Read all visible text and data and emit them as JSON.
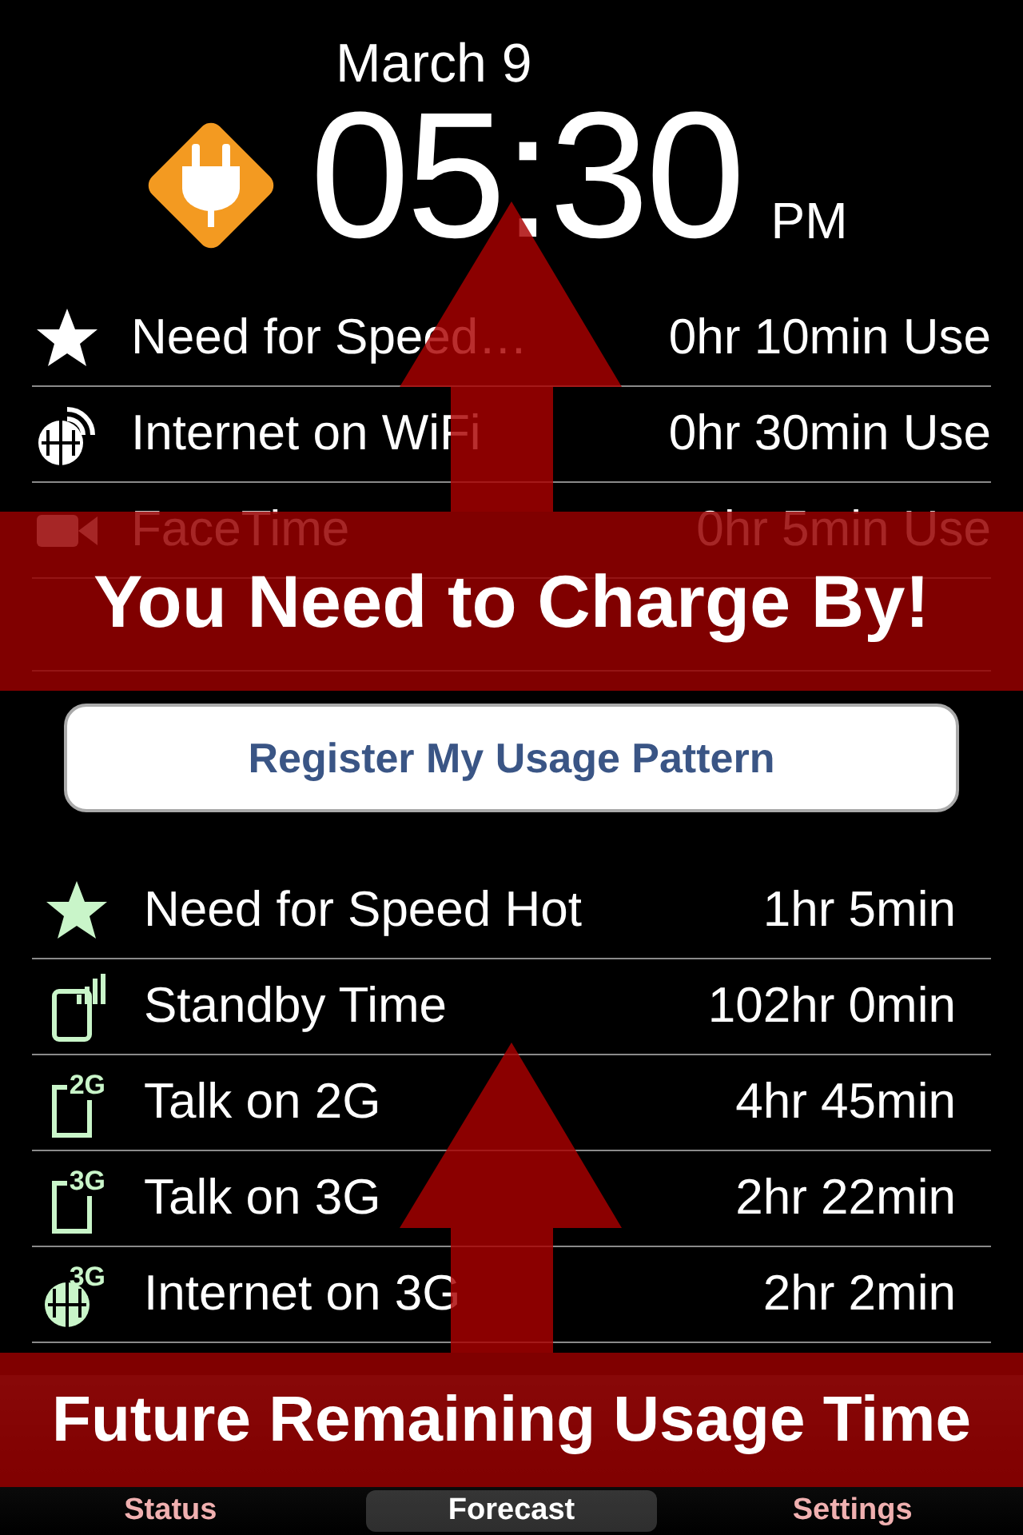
{
  "header": {
    "date": "March 9",
    "time": "05:30",
    "meridiem": "PM"
  },
  "usage": [
    {
      "kind": "star",
      "name": "Need for Speed…",
      "value": "0hr 10min Use"
    },
    {
      "kind": "wifi",
      "name": "Internet on WiFi",
      "value": "0hr 30min Use"
    },
    {
      "kind": "video",
      "name": "FaceTime",
      "value": "0hr 5min Use"
    }
  ],
  "register_button": "Register My Usage Pattern",
  "forecast": [
    {
      "kind": "star",
      "name": "Need for Speed Hot",
      "value": "1hr 5min"
    },
    {
      "kind": "standby",
      "name": "Standby Time",
      "value": "102hr 0min"
    },
    {
      "kind": "talk",
      "badge": "2G",
      "name": "Talk on 2G",
      "value": "4hr 45min"
    },
    {
      "kind": "talk",
      "badge": "3G",
      "name": "Talk on 3G",
      "value": "2hr 22min"
    },
    {
      "kind": "internet",
      "badge": "3G",
      "name": "Internet on 3G",
      "value": "2hr 2min"
    }
  ],
  "tabs": [
    {
      "label": "Status",
      "selected": false
    },
    {
      "label": "Forecast",
      "selected": true
    },
    {
      "label": "Settings",
      "selected": false
    }
  ],
  "banners": [
    "You Need to Charge By!",
    "Future Remaining Usage Time"
  ]
}
